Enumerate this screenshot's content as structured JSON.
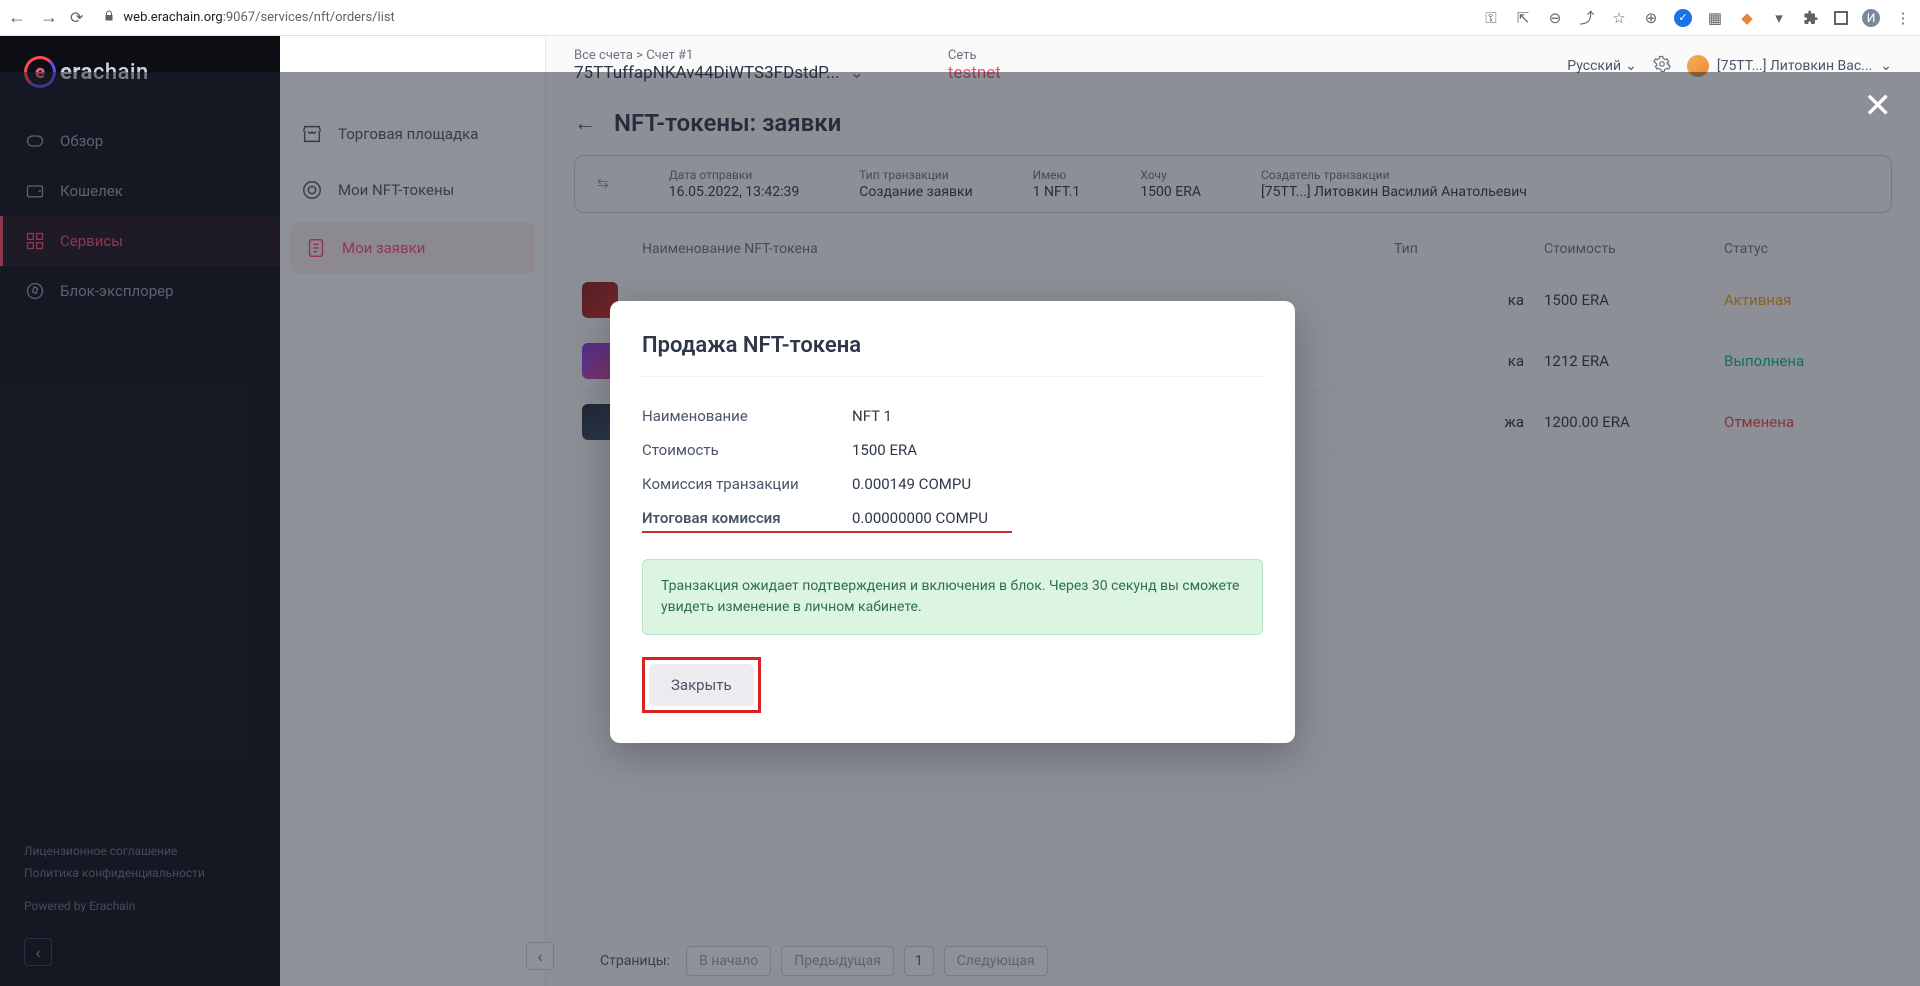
{
  "browser": {
    "url_host": "web.erachain.org",
    "url_port": ":9067",
    "url_path": "/services/nft/orders/list"
  },
  "sidebar": {
    "logo_text_bold": "era",
    "logo_text_rest": "chain",
    "items": [
      {
        "label": "Обзор"
      },
      {
        "label": "Кошелек"
      },
      {
        "label": "Сервисы"
      },
      {
        "label": "Блок-эксплорер"
      }
    ],
    "footer": {
      "license": "Лицензионное соглашение",
      "privacy": "Политика конфиденциальности",
      "powered": "Powered by Erachain"
    }
  },
  "subsidebar": {
    "items": [
      {
        "label": "Торговая площадка"
      },
      {
        "label": "Мои NFT-токены"
      },
      {
        "label": "Мои заявки"
      }
    ]
  },
  "topbar": {
    "breadcrumb": "Все счета > Счет #1",
    "account_addr": "75TTuffapNKAv44DiWTS3FDstdP...",
    "network_label": "Сеть",
    "network_value": "testnet",
    "language": "Русский",
    "user_label": "[75TT...] Литовкин Вас..."
  },
  "page": {
    "title": "NFT-токены: заявки",
    "tx": {
      "date_label": "Дата отправки",
      "date_value": "16.05.2022, 13:42:39",
      "type_label": "Тип транзакции",
      "type_value": "Создание заявки",
      "have_label": "Имею",
      "have_value": "1 NFT.1",
      "want_label": "Хочу",
      "want_value": "1500 ERA",
      "creator_label": "Создатель транзакции",
      "creator_value": "[75TT...] Литовкин Василий Анатольевич"
    },
    "table": {
      "headers": {
        "name": "Наименование NFT-токена",
        "type": "Тип",
        "cost": "Стоимость",
        "status": "Статус"
      },
      "rows": [
        {
          "name": "",
          "type_suffix": "ка",
          "cost": "1500 ERA",
          "status": "Активная",
          "status_cls": "st-active"
        },
        {
          "name": "",
          "type_suffix": "ка",
          "cost": "1212 ERA",
          "status": "Выполнена",
          "status_cls": "st-done"
        },
        {
          "name": "",
          "type_suffix": "жа",
          "cost": "1200.00 ERA",
          "status": "Отменена",
          "status_cls": "st-cancel"
        }
      ]
    },
    "pager": {
      "label": "Страницы:",
      "first": "В начало",
      "prev": "Предыдущая",
      "page": "1",
      "next": "Следующая"
    }
  },
  "modal": {
    "title": "Продажа NFT-токена",
    "rows": {
      "name_label": "Наименование",
      "name_value": "NFT 1",
      "cost_label": "Стоимость",
      "cost_value": "1500 ERA",
      "fee_label": "Комиссия транзакции",
      "fee_value": "0.000149 COMPU",
      "total_label": "Итоговая комиссия",
      "total_value": "0.00000000 COMPU"
    },
    "success_text": "Транзакция ожидает подтверждения и включения в блок. Через 30 секунд вы сможете увидеть изменение в личном кабинете.",
    "close_label": "Закрыть"
  }
}
